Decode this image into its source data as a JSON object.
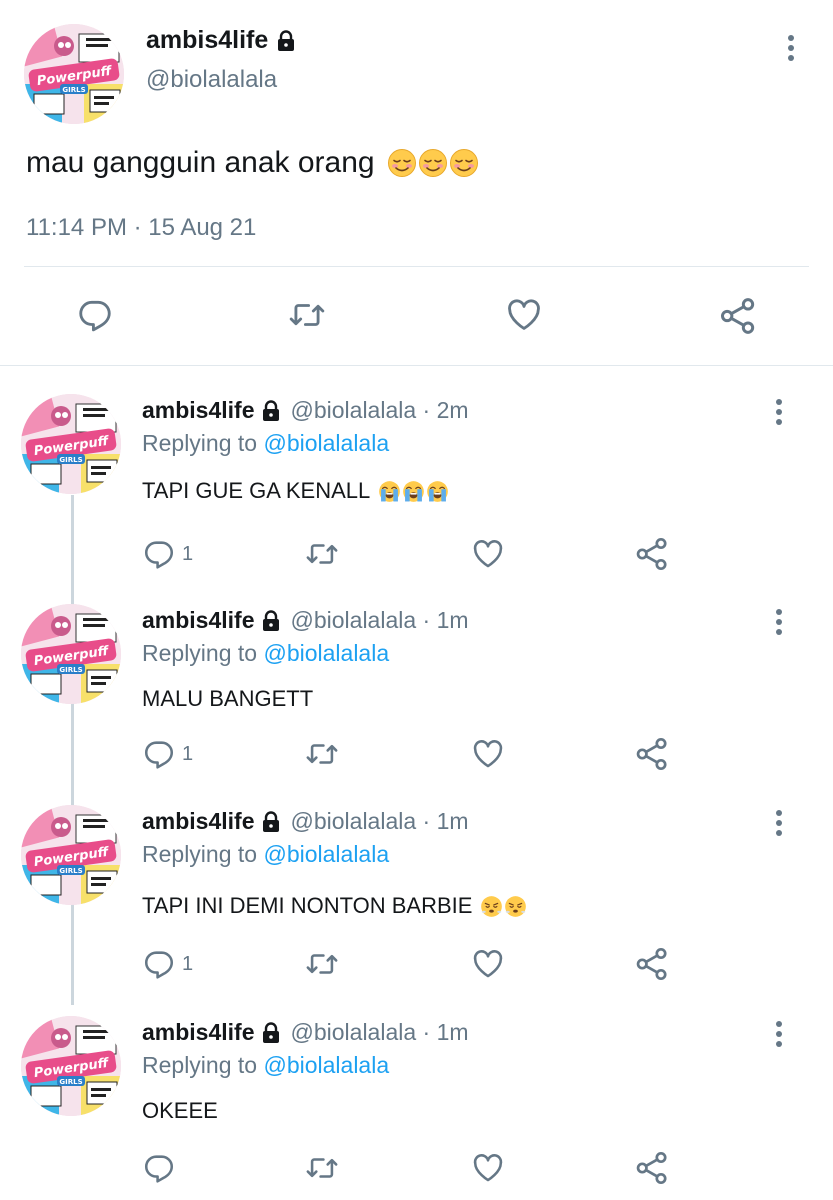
{
  "main_tweet": {
    "name": "ambis4life",
    "handle": "@biolalalala",
    "text": "mau gangguin anak orang",
    "text_emojis": [
      "smiling-face-emoji",
      "smiling-face-emoji",
      "smiling-face-emoji"
    ],
    "timestamp": "11:14 PM · 15 Aug 21",
    "actions": [
      "reply-icon",
      "retweet-icon",
      "like-icon",
      "share-icon"
    ]
  },
  "replies": [
    {
      "name": "ambis4life",
      "handle_time": "@biolalalala · 2m",
      "replying_prefix": "Replying to",
      "replying_handle": "@biolalalala",
      "text": "TAPI GUE GA KENALL",
      "emojis": [
        "loudly-crying-face-emoji",
        "loudly-crying-face-emoji",
        "loudly-crying-face-emoji"
      ],
      "reply_count": "1"
    },
    {
      "name": "ambis4life",
      "handle_time": "@biolalalala · 1m",
      "replying_prefix": "Replying to",
      "replying_handle": "@biolalalala",
      "text": "MALU BANGETT",
      "emojis": [],
      "reply_count": "1"
    },
    {
      "name": "ambis4life",
      "handle_time": "@biolalalala · 1m",
      "replying_prefix": "Replying to",
      "replying_handle": "@biolalalala",
      "text": "TAPI INI DEMI NONTON BARBIE",
      "emojis": [
        "face-with-steam-emoji",
        "face-with-steam-emoji"
      ],
      "reply_count": "1"
    },
    {
      "name": "ambis4life",
      "handle_time": "@biolalalala · 1m",
      "replying_prefix": "Replying to",
      "replying_handle": "@biolalalala",
      "text": "OKEEE",
      "emojis": [],
      "reply_count": ""
    }
  ],
  "colors": {
    "text": "#14171a",
    "secondary": "#657786",
    "link": "#1da1f2",
    "divider": "#e1e8ed",
    "thread_line": "#ccd6dd"
  }
}
